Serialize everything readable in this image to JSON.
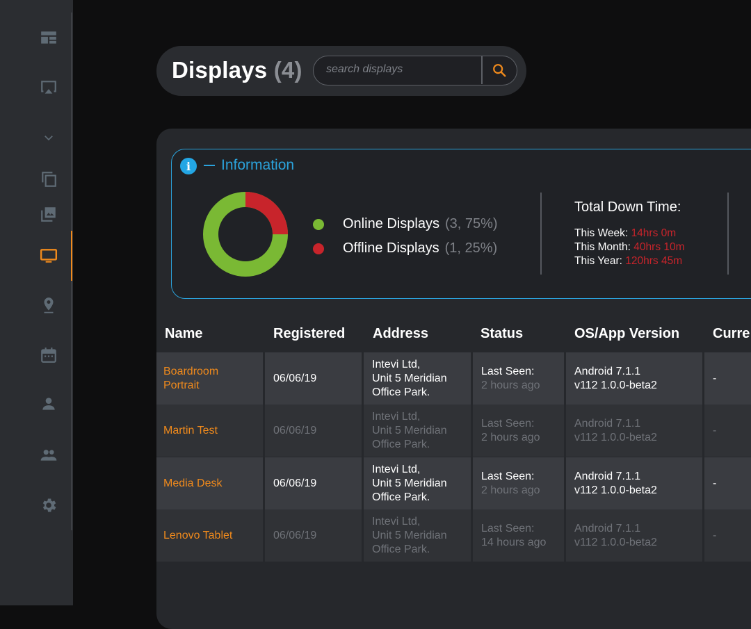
{
  "colors": {
    "accent": "#f08a1c",
    "info": "#2ba3dc",
    "online": "#7ab934",
    "offline": "#c8242b"
  },
  "sidebar": {
    "items": [
      {
        "icon": "dashboard-icon"
      },
      {
        "icon": "cast-icon"
      },
      {
        "icon": "chevron-down-icon"
      },
      {
        "icon": "copy-icon"
      },
      {
        "icon": "gallery-icon"
      },
      {
        "icon": "monitor-icon",
        "active": true
      },
      {
        "icon": "location-pin-icon"
      },
      {
        "icon": "calendar-icon"
      },
      {
        "icon": "user-icon"
      },
      {
        "icon": "group-icon"
      },
      {
        "icon": "settings-icon"
      }
    ]
  },
  "header": {
    "title": "Displays",
    "count": "(4)",
    "search_placeholder": "search displays"
  },
  "info": {
    "title": "Information",
    "online_label": "Online Displays",
    "online_stat": "(3, 75%)",
    "offline_label": "Offline Displays",
    "offline_stat": "(1, 25%)",
    "online_fraction": 0.75,
    "offline_fraction": 0.25,
    "downtime_title": "Total Down Time:",
    "week_label": "This Week",
    "week_value": "14hrs 0m",
    "month_label": "This Month",
    "month_value": "40hrs 10m",
    "year_label": "This Year",
    "year_value": "120hrs 45m"
  },
  "table": {
    "headers": [
      "Name",
      "Registered",
      "Address",
      "Status",
      "OS/App Version",
      "Curre"
    ],
    "rows": [
      {
        "name_1": "Boardroom",
        "name_2": "Portrait",
        "registered": "06/06/19",
        "addr_1": "Intevi Ltd,",
        "addr_2": "Unit 5 Meridian",
        "addr_3": "Office Park.",
        "status_label": "Last Seen:",
        "status_time": "2 hours ago",
        "os_1": "Android 7.1.1",
        "os_2": "v112 1.0.0-beta2",
        "current": "-"
      },
      {
        "name_1": "Martin Test",
        "registered": "06/06/19",
        "addr_1": "Intevi Ltd,",
        "addr_2": "Unit 5 Meridian",
        "addr_3": "Office Park.",
        "status_label": "Last Seen:",
        "status_time": "2 hours ago",
        "os_1": "Android 7.1.1",
        "os_2": "v112 1.0.0-beta2",
        "current": "-"
      },
      {
        "name_1": "Media Desk",
        "registered": "06/06/19",
        "addr_1": "Intevi Ltd,",
        "addr_2": "Unit 5 Meridian",
        "addr_3": "Office Park.",
        "status_label": "Last Seen:",
        "status_time": "2 hours ago",
        "os_1": "Android 7.1.1",
        "os_2": "v112 1.0.0-beta2",
        "current": "-"
      },
      {
        "name_1": "Lenovo Tablet",
        "registered": "06/06/19",
        "addr_1": "Intevi Ltd,",
        "addr_2": "Unit 5 Meridian",
        "addr_3": "Office Park.",
        "status_label": "Last Seen:",
        "status_time": "14 hours ago",
        "os_1": "Android 7.1.1",
        "os_2": "v112 1.0.0-beta2",
        "current": "-"
      }
    ]
  }
}
